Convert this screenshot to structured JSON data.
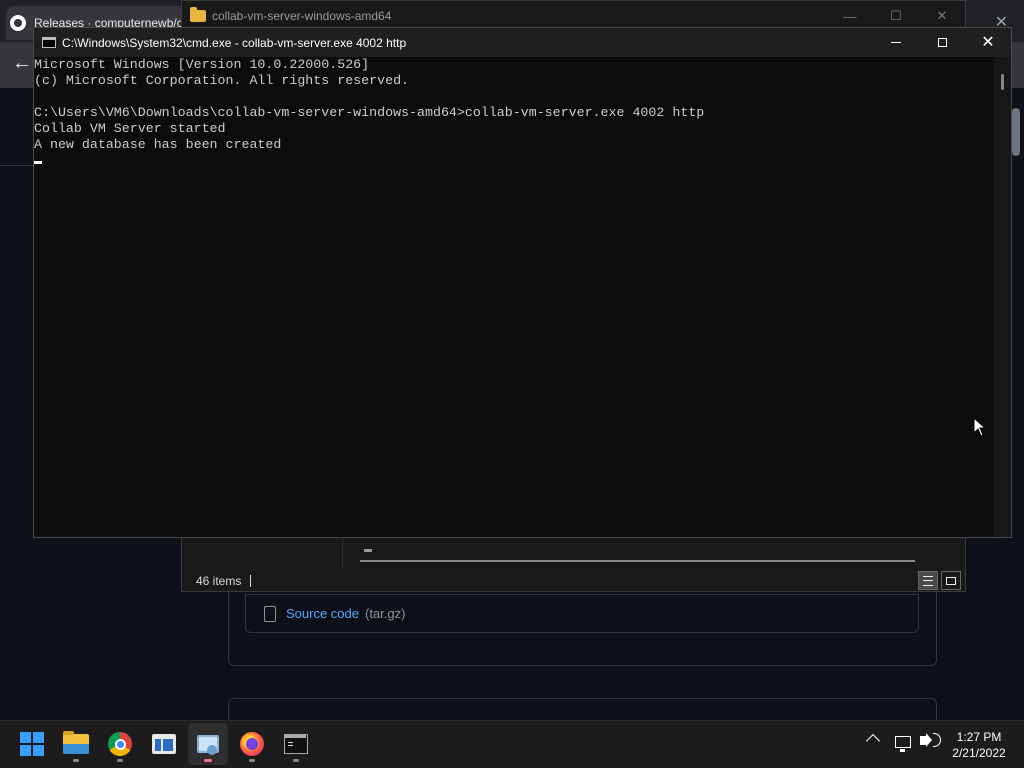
{
  "browser": {
    "tab_title": "Releases · computernewb/cc",
    "close_symbol": "✕",
    "back_symbol": "←"
  },
  "release_asset": {
    "link_text": "Source code",
    "ext_text": "(tar.gz)"
  },
  "explorer": {
    "title": "collab-vm-server-windows-amd64",
    "item_count": "46 items",
    "minimize_symbol": "—",
    "maximize_symbol": "☐",
    "close_symbol": "✕"
  },
  "cmd": {
    "title": "C:\\Windows\\System32\\cmd.exe - collab-vm-server.exe  4002 http",
    "close_symbol": "✕",
    "lines": [
      "Microsoft Windows [Version 10.0.22000.526]",
      "(c) Microsoft Corporation. All rights reserved.",
      "",
      "C:\\Users\\VM6\\Downloads\\collab-vm-server-windows-amd64>collab-vm-server.exe 4002 http",
      "Collab VM Server started",
      "A new database has been created"
    ]
  },
  "taskbar": {
    "items": [
      "start-menu",
      "file-explorer",
      "chrome",
      "window-app",
      "remote-desktop",
      "firefox",
      "command-prompt"
    ],
    "clock_time": "1:27 PM",
    "clock_date": "2/21/2022"
  }
}
